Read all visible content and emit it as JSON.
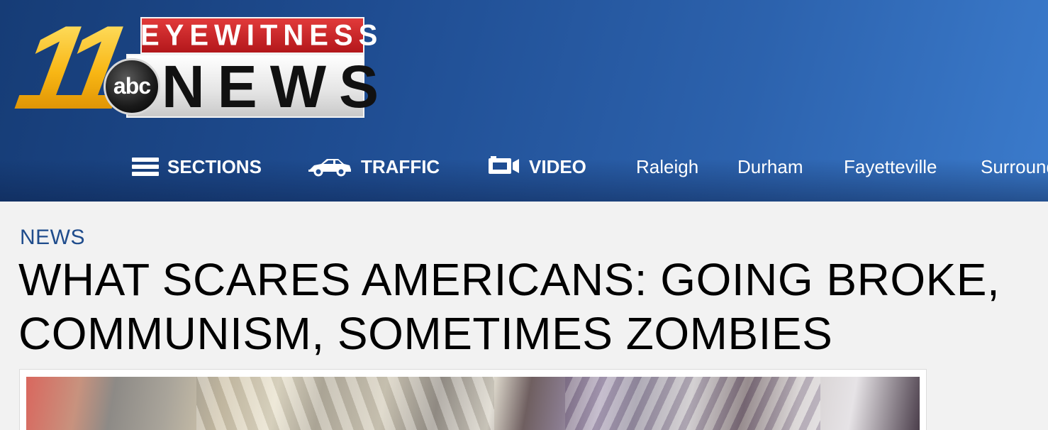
{
  "logo": {
    "number": "11",
    "top_word": "EYEWITNESS",
    "network": "abc",
    "bottom_word": "NEWS"
  },
  "nav": {
    "sections": {
      "label": "SECTIONS",
      "icon": "hamburger-menu-icon"
    },
    "traffic": {
      "label": "TRAFFIC",
      "icon": "car-icon"
    },
    "video": {
      "label": "VIDEO",
      "icon": "video-camera-icon"
    },
    "locations": [
      "Raleigh",
      "Durham",
      "Fayetteville",
      "Surround"
    ]
  },
  "article": {
    "category": "NEWS",
    "headline_line1": "WHAT SCARES AMERICANS: GOING BROKE,",
    "headline_line2": "COMMUNISM, SOMETIMES ZOMBIES"
  },
  "colors": {
    "header_dark": "#163c76",
    "header_light": "#3b7bcc",
    "category": "#1f4c8c",
    "logo_red": "#b3171b",
    "logo_gold": "#f6b20b"
  }
}
